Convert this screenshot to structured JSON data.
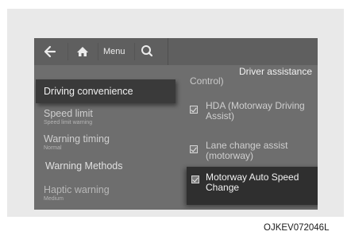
{
  "toolbar": {
    "menu_label": "Menu"
  },
  "page_title": "Driver assistance",
  "left_panel": {
    "selected_item": "Driving convenience",
    "items": [
      {
        "label": "Speed limit",
        "sub": "Speed limit warning"
      },
      {
        "label": "Warning timing",
        "sub": "Normal"
      }
    ],
    "section_heading": "Warning Methods",
    "last_item": {
      "label": "Haptic warning",
      "sub": "Medium"
    }
  },
  "right_panel": {
    "partial_text": "Control)",
    "items": [
      {
        "label": "HDA (Motorway Driving Assist)",
        "checked": true
      },
      {
        "label": "Lane change assist (motorway)",
        "checked": true
      }
    ],
    "selected_item": {
      "label": "Motorway Auto Speed Change",
      "checked": true
    }
  },
  "caption": "OJKEV072046L"
}
